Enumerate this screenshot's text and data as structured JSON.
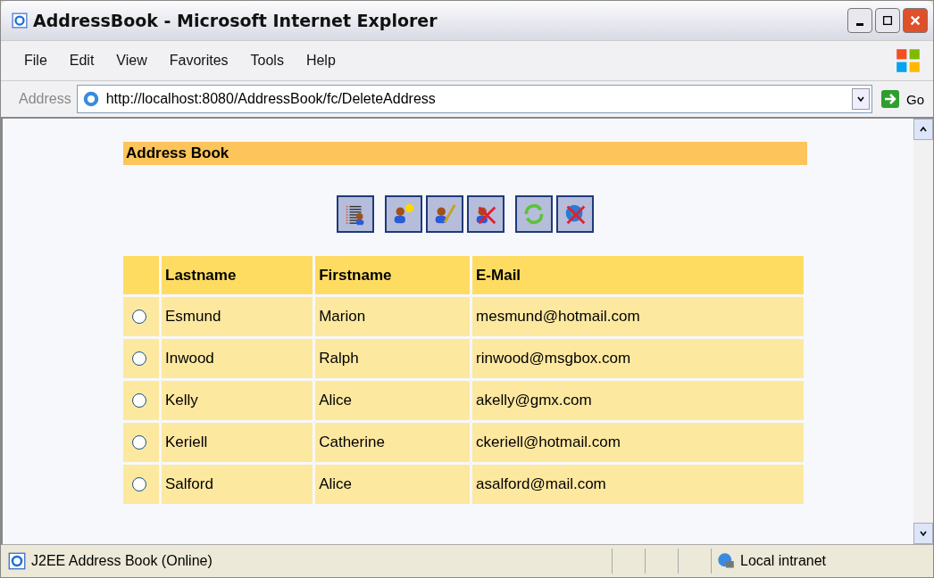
{
  "window": {
    "title": "AddressBook - Microsoft Internet Explorer"
  },
  "menu": [
    "File",
    "Edit",
    "View",
    "Favorites",
    "Tools",
    "Help"
  ],
  "address_bar": {
    "label": "Address",
    "value": "http://localhost:8080/AddressBook/fc/DeleteAddress",
    "go": "Go"
  },
  "page": {
    "heading": "Address Book",
    "toolbar": [
      [
        {
          "kind": "list"
        }
      ],
      [
        {
          "kind": "add"
        },
        {
          "kind": "edit"
        },
        {
          "kind": "delete"
        }
      ],
      [
        {
          "kind": "refresh"
        },
        {
          "kind": "disconnect"
        }
      ]
    ],
    "table": {
      "columns": [
        "Lastname",
        "Firstname",
        "E-Mail"
      ],
      "rows": [
        {
          "selected": false,
          "cells": [
            "Esmund",
            "Marion",
            "mesmund@hotmail.com"
          ]
        },
        {
          "selected": false,
          "cells": [
            "Inwood",
            "Ralph",
            "rinwood@msgbox.com"
          ]
        },
        {
          "selected": false,
          "cells": [
            "Kelly",
            "Alice",
            "akelly@gmx.com"
          ]
        },
        {
          "selected": false,
          "cells": [
            "Keriell",
            "Catherine",
            "ckeriell@hotmail.com"
          ]
        },
        {
          "selected": false,
          "cells": [
            "Salford",
            "Alice",
            "asalford@mail.com"
          ]
        }
      ]
    }
  },
  "status_bar": {
    "text": "J2EE Address Book (Online)",
    "zone": "Local intranet"
  }
}
